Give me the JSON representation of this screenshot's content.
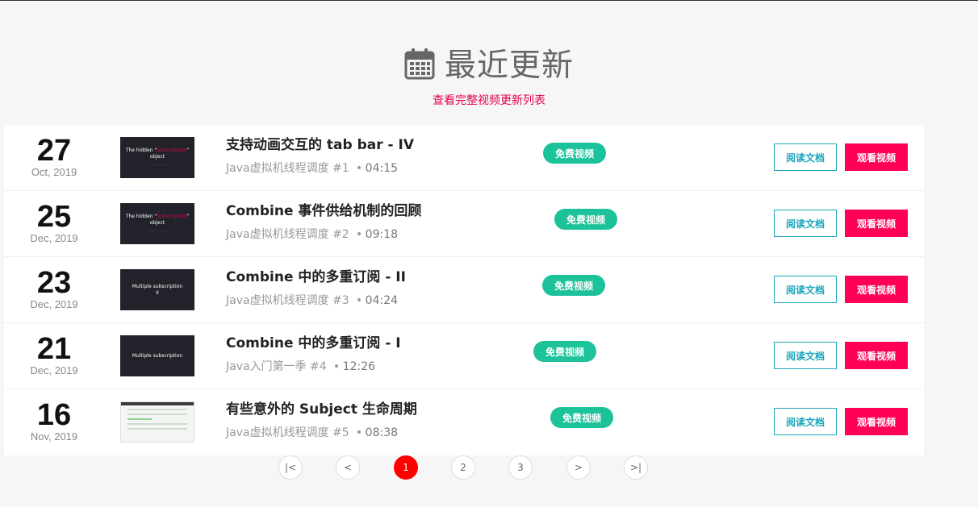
{
  "header": {
    "title": "最近更新",
    "subtitle_link": "查看完整视频更新列表",
    "icon": "calendar-icon"
  },
  "colors": {
    "accent": "#ff0055",
    "link": "#e6004c",
    "badge": "#1cc29a",
    "read_button": "#1ba6bd",
    "active_page": "#ff0000"
  },
  "videos": [
    {
      "day": "27",
      "month_year": "Oct, 2019",
      "title": "支持动画交互的 tab bar - IV",
      "series": "Java虚拟机线程调度 #1",
      "duration": "04:15",
      "badge": "免费视频",
      "read_label": "阅读文档",
      "watch_label": "观看视频",
      "thumb": {
        "pre": "The hidden \"",
        "highlight": "Subscription",
        "post": "\" object"
      }
    },
    {
      "day": "25",
      "month_year": "Dec, 2019",
      "title": "Combine 事件供给机制的回顾",
      "series": "Java虚拟机线程调度 #2",
      "duration": "09:18",
      "badge": "免费视频",
      "read_label": "阅读文档",
      "watch_label": "观看视频",
      "thumb": {
        "pre": "The hidden \"",
        "highlight": "Subscription",
        "post": "\" object"
      }
    },
    {
      "day": "23",
      "month_year": "Dec, 2019",
      "title": "Combine 中的多重订阅 - II",
      "series": "Java虚拟机线程调度 #3",
      "duration": "04:24",
      "badge": "免费视频",
      "read_label": "阅读文档",
      "watch_label": "观看视频",
      "thumb": {
        "line1": "Multiple subscription",
        "line2": "II"
      }
    },
    {
      "day": "21",
      "month_year": "Dec, 2019",
      "title": "Combine 中的多重订阅 - I",
      "series": "Java入门第一季 #4",
      "duration": "12:26",
      "badge": "免费视频",
      "read_label": "阅读文档",
      "watch_label": "观看视频",
      "thumb": {
        "line1": "Multiple subscription"
      }
    },
    {
      "day": "16",
      "month_year": "Nov, 2019",
      "title": "有些意外的 Subject 生命周期",
      "series": "Java虚拟机线程调度 #5",
      "duration": "08:38",
      "badge": "免费视频",
      "read_label": "阅读文档",
      "watch_label": "观看视频"
    }
  ],
  "pagination": {
    "first": "|<",
    "prev": "<",
    "pages": [
      "1",
      "2",
      "3"
    ],
    "current": "1",
    "next": ">",
    "last": ">|"
  }
}
